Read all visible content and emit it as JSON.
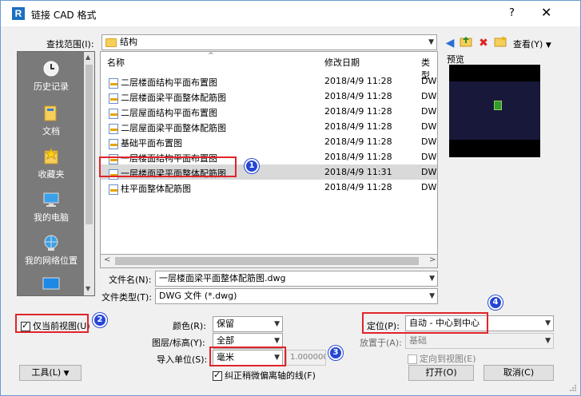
{
  "window": {
    "title": "链接 CAD 格式",
    "help": "?",
    "close": "✕",
    "logo": "R"
  },
  "lookin": {
    "label": "查找范围(I):",
    "value": "结构",
    "view_label": "查看(Y)"
  },
  "sidebar": {
    "items": [
      {
        "label": "历史记录",
        "icon": "history-icon"
      },
      {
        "label": "文档",
        "icon": "documents-icon"
      },
      {
        "label": "收藏夹",
        "icon": "favorites-icon"
      },
      {
        "label": "我的电脑",
        "icon": "computer-icon"
      },
      {
        "label": "我的网络位置",
        "icon": "network-icon"
      }
    ]
  },
  "filelist": {
    "headers": {
      "name": "名称",
      "date": "修改日期",
      "type": "类型"
    },
    "rows": [
      {
        "name": "二层楼面结构平面布置图",
        "date": "2018/4/9 11:28",
        "type": "DW(",
        "selected": false
      },
      {
        "name": "二层楼面梁平面整体配筋图",
        "date": "2018/4/9 11:28",
        "type": "DW(",
        "selected": false
      },
      {
        "name": "二层屋面结构平面布置图",
        "date": "2018/4/9 11:28",
        "type": "DW(",
        "selected": false
      },
      {
        "name": "二层屋面梁平面整体配筋图",
        "date": "2018/4/9 11:28",
        "type": "DW(",
        "selected": false
      },
      {
        "name": "基础平面布置图",
        "date": "2018/4/9 11:28",
        "type": "DW(",
        "selected": false
      },
      {
        "name": "一层楼面结构平面布置图",
        "date": "2018/4/9 11:28",
        "type": "DW(",
        "selected": false
      },
      {
        "name": "一层楼面梁平面整体配筋图",
        "date": "2018/4/9 11:31",
        "type": "DW(",
        "selected": true
      },
      {
        "name": "柱平面整体配筋图",
        "date": "2018/4/9 11:28",
        "type": "DW(",
        "selected": false
      }
    ]
  },
  "preview_label": "预览",
  "filename": {
    "label": "文件名(N):",
    "value": "一层楼面梁平面整体配筋图.dwg"
  },
  "filetype": {
    "label": "文件类型(T):",
    "value": "DWG 文件 (*.dwg)"
  },
  "options": {
    "current_view_only": "仅当前视图(U)",
    "color_label": "颜色(R):",
    "color_value": "保留",
    "layers_label": "图层/标高(Y):",
    "layers_value": "全部",
    "units_label": "导入单位(S):",
    "units_value": "毫米",
    "scale_value": "1.000000",
    "correct_lines": "纠正稍微偏离轴的线(F)",
    "position_label": "定位(P):",
    "position_value": "自动 - 中心到中心",
    "place_label": "放置于(A):",
    "place_value": "基础",
    "orient_to_view": "定向到视图(E)"
  },
  "buttons": {
    "tools": "工具(L)",
    "open": "打开(O)",
    "cancel": "取消(C)"
  },
  "badges": [
    "1",
    "2",
    "3",
    "4"
  ],
  "colors": {
    "annotation_red": "#e0242a",
    "badge_blue": "#2546d6",
    "sidebar_gray": "#7a7a7a"
  }
}
